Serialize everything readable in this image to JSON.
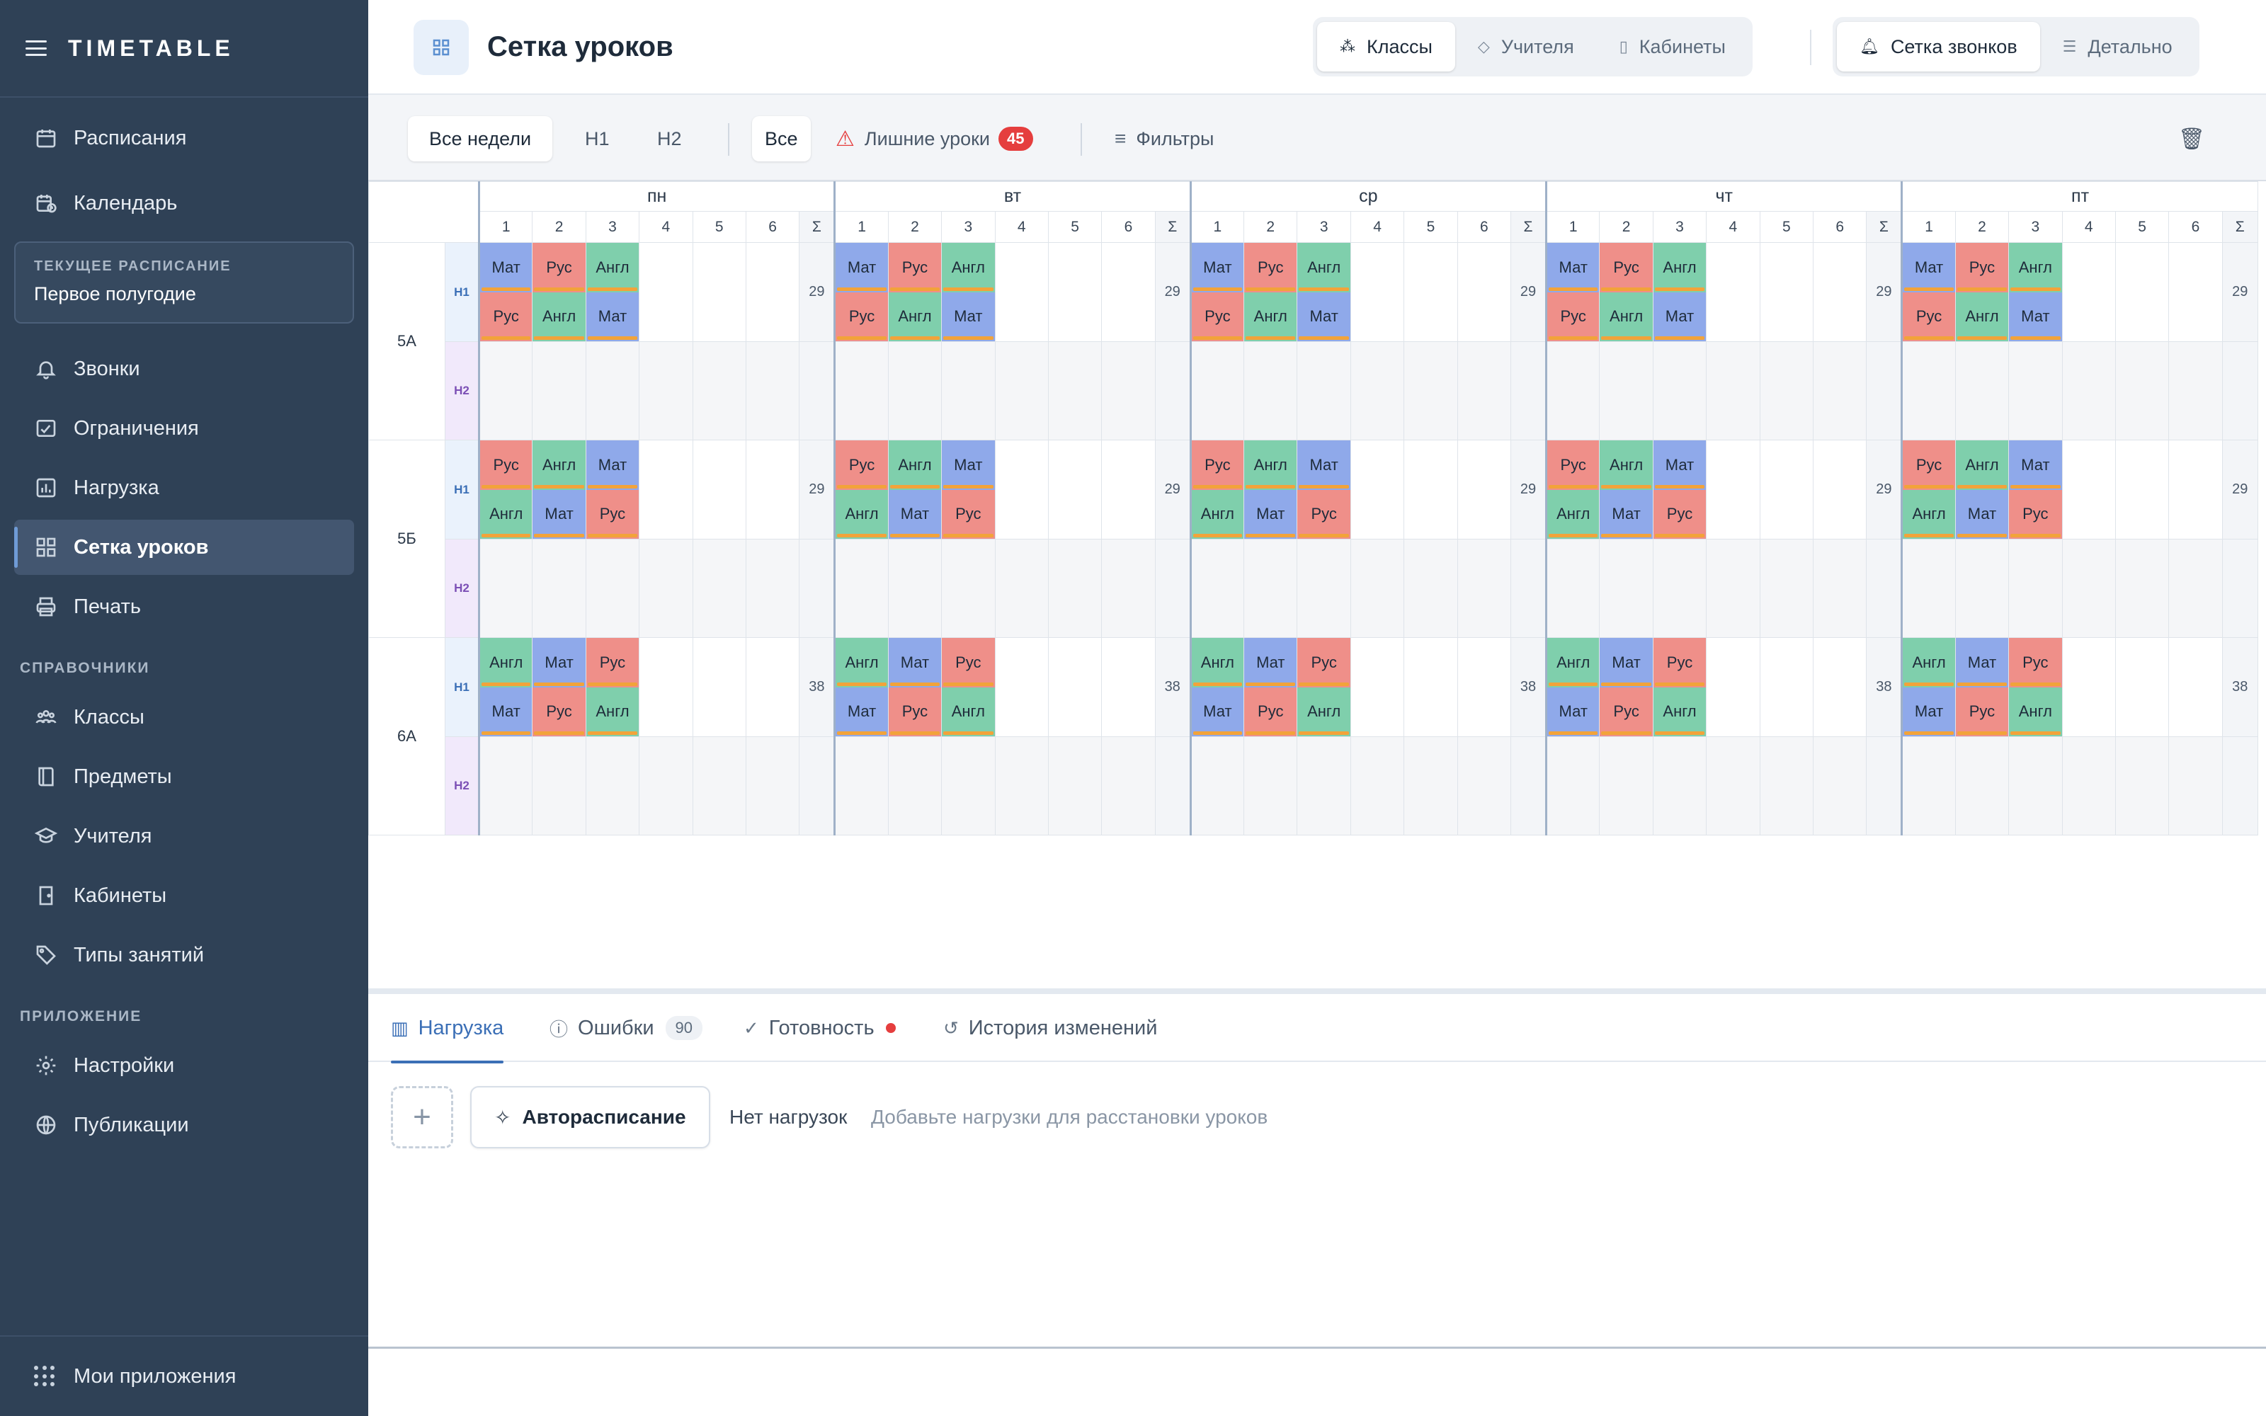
{
  "sidebar": {
    "brand": "TIMETABLE",
    "items_top": [
      {
        "label": "Расписания",
        "icon": "calendar-icon"
      },
      {
        "label": "Календарь",
        "icon": "calendar-clock-icon"
      }
    ],
    "current": {
      "label": "ТЕКУЩЕЕ РАСПИСАНИЕ",
      "value": "Первое полугодие"
    },
    "items_main": [
      {
        "label": "Звонки",
        "icon": "bell-icon"
      },
      {
        "label": "Ограничения",
        "icon": "restriction-icon"
      },
      {
        "label": "Нагрузка",
        "icon": "chart-icon"
      },
      {
        "label": "Сетка уроков",
        "icon": "grid-icon"
      },
      {
        "label": "Печать",
        "icon": "printer-icon"
      }
    ],
    "section_refs": "СПРАВОЧНИКИ",
    "items_refs": [
      {
        "label": "Классы",
        "icon": "people-icon"
      },
      {
        "label": "Предметы",
        "icon": "book-icon"
      },
      {
        "label": "Учителя",
        "icon": "graduation-cap-icon"
      },
      {
        "label": "Кабинеты",
        "icon": "door-icon"
      },
      {
        "label": "Типы занятий",
        "icon": "tag-icon"
      }
    ],
    "section_app": "ПРИЛОЖЕНИЕ",
    "items_app": [
      {
        "label": "Настройки",
        "icon": "gear-icon"
      },
      {
        "label": "Публикации",
        "icon": "globe-icon"
      }
    ],
    "footer": "Мои приложения"
  },
  "header": {
    "title": "Сетка уроков",
    "view_tabs": [
      "Классы",
      "Учителя",
      "Кабинеты"
    ],
    "mode_tabs": [
      "Сетка звонков",
      "Детально"
    ]
  },
  "toolbar": {
    "weeks": [
      "Все недели",
      "Н1",
      "Н2"
    ],
    "all": "Все",
    "extra_label": "Лишние уроки",
    "extra_count": "45",
    "filters": "Фильтры"
  },
  "grid": {
    "days": [
      "пн",
      "вт",
      "ср",
      "чт",
      "пт"
    ],
    "periods": [
      "1",
      "2",
      "3",
      "4",
      "5",
      "6"
    ],
    "sum_symbol": "Σ",
    "week_labels": [
      "Н1",
      "Н2"
    ],
    "classes": [
      {
        "name": "5А",
        "sum": "29",
        "top": [
          "Мат",
          "Рус",
          "Англ"
        ],
        "bottom": [
          "Рус",
          "Англ",
          "Мат"
        ]
      },
      {
        "name": "5Б",
        "sum": "29",
        "top": [
          "Рус",
          "Англ",
          "Мат"
        ],
        "bottom": [
          "Англ",
          "Мат",
          "Рус"
        ]
      },
      {
        "name": "6А",
        "sum": "38",
        "top": [
          "Англ",
          "Мат",
          "Рус"
        ],
        "bottom": [
          "Мат",
          "Рус",
          "Англ"
        ]
      }
    ]
  },
  "bottom": {
    "tabs": {
      "load": "Нагрузка",
      "errors": "Ошибки",
      "errors_count": "90",
      "ready": "Готовность",
      "history": "История изменений"
    },
    "auto_button": "Авторасписание",
    "empty_title": "Нет нагрузок",
    "empty_hint": "Добавьте нагрузки для расстановки уроков"
  },
  "colors": {
    "sidebar_bg": "#2f4156",
    "accent": "#3b6fb6",
    "mat": "#8fa9ea",
    "rus": "#ef8f89",
    "angl": "#7fcfac",
    "lesson_bar": "#f2a33a",
    "badge": "#e53e3e"
  }
}
